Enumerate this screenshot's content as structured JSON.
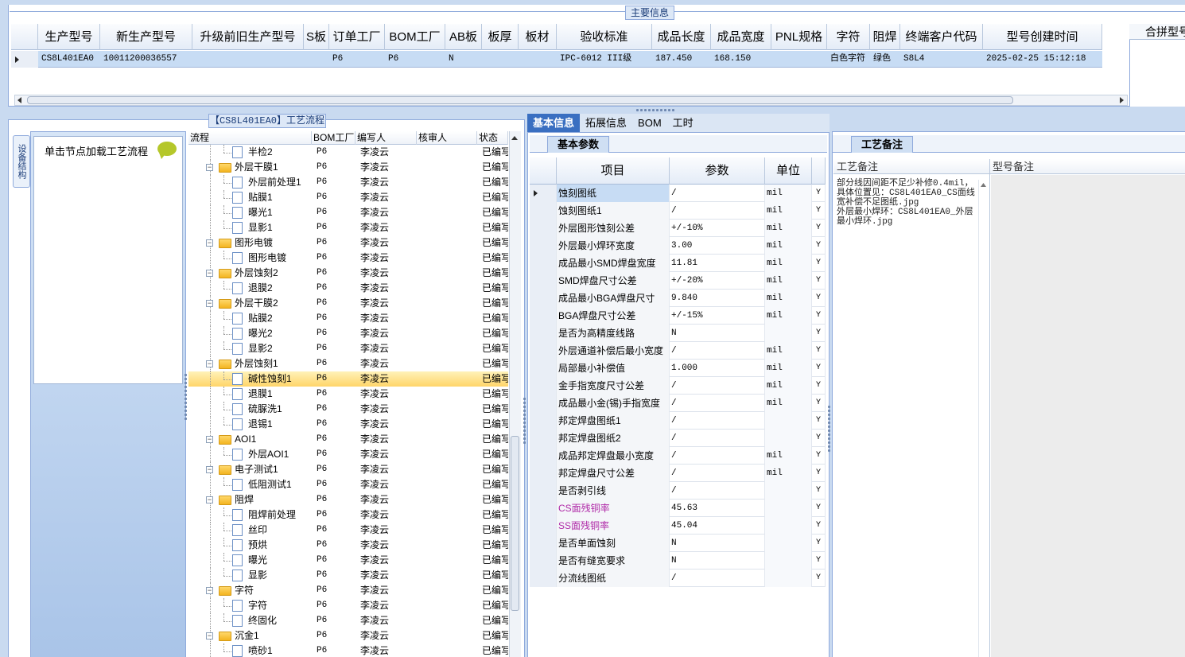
{
  "main_info": {
    "title": "主要信息",
    "columns": [
      "生产型号",
      "新生产型号",
      "升级前旧生产型号",
      "S板",
      "订单工厂",
      "BOM工厂",
      "AB板",
      "板厚",
      "板材",
      "验收标准",
      "成品长度",
      "成品宽度",
      "PNL规格",
      "字符",
      "阻焊",
      "终端客户代码",
      "型号创建时间"
    ],
    "row": [
      "CS8L401EA0",
      "10011200036557",
      "",
      "",
      "P6",
      "P6",
      "N",
      "",
      "",
      "IPC-6012 III级",
      "187.450",
      "168.150",
      "",
      "白色字符",
      "绿色",
      "S8L4",
      "2025-02-25 15:12:18"
    ],
    "right_panel_header": "合拼型号"
  },
  "flow_panel": {
    "title": "【CS8L401EA0】工艺流程",
    "side_tab": "设备结构",
    "hint": "单击节点加载工艺流程",
    "columns": [
      "流程",
      "BOM工厂",
      "编写人",
      "核审人",
      "状态"
    ],
    "nodes": [
      {
        "name": "半检2",
        "type": "doc",
        "level": 2,
        "bom": "P6",
        "writer": "李凌云",
        "reviewer": "",
        "status": "已编写"
      },
      {
        "name": "外层干膜1",
        "type": "folder",
        "level": 1,
        "bom": "P6",
        "writer": "李凌云",
        "reviewer": "",
        "status": "已编写"
      },
      {
        "name": "外层前处理1",
        "type": "doc",
        "level": 2,
        "bom": "P6",
        "writer": "李凌云",
        "reviewer": "",
        "status": "已编写"
      },
      {
        "name": "贴膜1",
        "type": "doc",
        "level": 2,
        "bom": "P6",
        "writer": "李凌云",
        "reviewer": "",
        "status": "已编写"
      },
      {
        "name": "曝光1",
        "type": "doc",
        "level": 2,
        "bom": "P6",
        "writer": "李凌云",
        "reviewer": "",
        "status": "已编写"
      },
      {
        "name": "显影1",
        "type": "doc",
        "level": 2,
        "bom": "P6",
        "writer": "李凌云",
        "reviewer": "",
        "status": "已编写"
      },
      {
        "name": "图形电镀",
        "type": "folder",
        "level": 1,
        "bom": "P6",
        "writer": "李凌云",
        "reviewer": "",
        "status": "已编写"
      },
      {
        "name": "图形电镀",
        "type": "doc",
        "level": 2,
        "bom": "P6",
        "writer": "李凌云",
        "reviewer": "",
        "status": "已编写"
      },
      {
        "name": "外层蚀刻2",
        "type": "folder",
        "level": 1,
        "bom": "P6",
        "writer": "李凌云",
        "reviewer": "",
        "status": "已编写"
      },
      {
        "name": "退膜2",
        "type": "doc",
        "level": 2,
        "bom": "P6",
        "writer": "李凌云",
        "reviewer": "",
        "status": "已编写"
      },
      {
        "name": "外层干膜2",
        "type": "folder",
        "level": 1,
        "bom": "P6",
        "writer": "李凌云",
        "reviewer": "",
        "status": "已编写"
      },
      {
        "name": "贴膜2",
        "type": "doc",
        "level": 2,
        "bom": "P6",
        "writer": "李凌云",
        "reviewer": "",
        "status": "已编写"
      },
      {
        "name": "曝光2",
        "type": "doc",
        "level": 2,
        "bom": "P6",
        "writer": "李凌云",
        "reviewer": "",
        "status": "已编写"
      },
      {
        "name": "显影2",
        "type": "doc",
        "level": 2,
        "bom": "P6",
        "writer": "李凌云",
        "reviewer": "",
        "status": "已编写"
      },
      {
        "name": "外层蚀刻1",
        "type": "folder",
        "level": 1,
        "bom": "P6",
        "writer": "李凌云",
        "reviewer": "",
        "status": "已编写"
      },
      {
        "name": "碱性蚀刻1",
        "type": "doc",
        "level": 2,
        "bom": "P6",
        "writer": "李凌云",
        "reviewer": "",
        "status": "已编写",
        "selected": true
      },
      {
        "name": "退膜1",
        "type": "doc",
        "level": 2,
        "bom": "P6",
        "writer": "李凌云",
        "reviewer": "",
        "status": "已编写"
      },
      {
        "name": "硫脲洗1",
        "type": "doc",
        "level": 2,
        "bom": "P6",
        "writer": "李凌云",
        "reviewer": "",
        "status": "已编写"
      },
      {
        "name": "退锡1",
        "type": "doc",
        "level": 2,
        "bom": "P6",
        "writer": "李凌云",
        "reviewer": "",
        "status": "已编写"
      },
      {
        "name": "AOI1",
        "type": "folder",
        "level": 1,
        "bom": "P6",
        "writer": "李凌云",
        "reviewer": "",
        "status": "已编写"
      },
      {
        "name": "外层AOI1",
        "type": "doc",
        "level": 2,
        "bom": "P6",
        "writer": "李凌云",
        "reviewer": "",
        "status": "已编写"
      },
      {
        "name": "电子测试1",
        "type": "folder",
        "level": 1,
        "bom": "P6",
        "writer": "李凌云",
        "reviewer": "",
        "status": "已编写"
      },
      {
        "name": "低阻测试1",
        "type": "doc",
        "level": 2,
        "bom": "P6",
        "writer": "李凌云",
        "reviewer": "",
        "status": "已编写"
      },
      {
        "name": "阻焊",
        "type": "folder",
        "level": 1,
        "bom": "P6",
        "writer": "李凌云",
        "reviewer": "",
        "status": "已编写"
      },
      {
        "name": "阻焊前处理",
        "type": "doc",
        "level": 2,
        "bom": "P6",
        "writer": "李凌云",
        "reviewer": "",
        "status": "已编写"
      },
      {
        "name": "丝印",
        "type": "doc",
        "level": 2,
        "bom": "P6",
        "writer": "李凌云",
        "reviewer": "",
        "status": "已编写"
      },
      {
        "name": "预烘",
        "type": "doc",
        "level": 2,
        "bom": "P6",
        "writer": "李凌云",
        "reviewer": "",
        "status": "已编写"
      },
      {
        "name": "曝光",
        "type": "doc",
        "level": 2,
        "bom": "P6",
        "writer": "李凌云",
        "reviewer": "",
        "status": "已编写"
      },
      {
        "name": "显影",
        "type": "doc",
        "level": 2,
        "bom": "P6",
        "writer": "李凌云",
        "reviewer": "",
        "status": "已编写"
      },
      {
        "name": "字符",
        "type": "folder",
        "level": 1,
        "bom": "P6",
        "writer": "李凌云",
        "reviewer": "",
        "status": "已编写"
      },
      {
        "name": "字符",
        "type": "doc",
        "level": 2,
        "bom": "P6",
        "writer": "李凌云",
        "reviewer": "",
        "status": "已编写"
      },
      {
        "name": "终固化",
        "type": "doc",
        "level": 2,
        "bom": "P6",
        "writer": "李凌云",
        "reviewer": "",
        "status": "已编写"
      },
      {
        "name": "沉金1",
        "type": "folder",
        "level": 1,
        "bom": "P6",
        "writer": "李凌云",
        "reviewer": "",
        "status": "已编写"
      },
      {
        "name": "喷砂1",
        "type": "doc",
        "level": 2,
        "bom": "P6",
        "writer": "李凌云",
        "reviewer": "",
        "status": "已编写"
      }
    ]
  },
  "detail_panel": {
    "tabs": [
      "基本信息",
      "拓展信息",
      "BOM",
      "工时"
    ],
    "active_tab": 0,
    "subtab": "基本参数",
    "columns": [
      "项目",
      "参数",
      "单位"
    ],
    "params": [
      {
        "item": "蚀刻图纸",
        "value": "/",
        "unit": "mil",
        "flag": "Y",
        "current": true
      },
      {
        "item": "蚀刻图纸1",
        "value": "/",
        "unit": "mil",
        "flag": "Y"
      },
      {
        "item": "外层图形蚀刻公差",
        "value": "+/-10%",
        "unit": "mil",
        "flag": "Y"
      },
      {
        "item": "外层最小焊环宽度",
        "value": "3.00",
        "unit": "mil",
        "flag": "Y"
      },
      {
        "item": "成品最小SMD焊盘宽度",
        "value": "11.81",
        "unit": "mil",
        "flag": "Y"
      },
      {
        "item": "SMD焊盘尺寸公差",
        "value": "+/-20%",
        "unit": "mil",
        "flag": "Y"
      },
      {
        "item": "成品最小BGA焊盘尺寸",
        "value": "9.840",
        "unit": "mil",
        "flag": "Y"
      },
      {
        "item": "BGA焊盘尺寸公差",
        "value": "+/-15%",
        "unit": "mil",
        "flag": "Y"
      },
      {
        "item": "是否为高精度线路",
        "value": "N",
        "unit": "",
        "flag": "Y"
      },
      {
        "item": "外层通道补偿后最小宽度",
        "value": "/",
        "unit": "mil",
        "flag": "Y"
      },
      {
        "item": "局部最小补偿值",
        "value": "1.000",
        "unit": "mil",
        "flag": "Y"
      },
      {
        "item": "金手指宽度尺寸公差",
        "value": "/",
        "unit": "mil",
        "flag": "Y"
      },
      {
        "item": "成品最小金(锡)手指宽度",
        "value": "/",
        "unit": "mil",
        "flag": "Y"
      },
      {
        "item": "邦定焊盘图纸1",
        "value": "/",
        "unit": "",
        "flag": "Y"
      },
      {
        "item": "邦定焊盘图纸2",
        "value": "/",
        "unit": "",
        "flag": "Y"
      },
      {
        "item": "成品邦定焊盘最小宽度",
        "value": "/",
        "unit": "mil",
        "flag": "Y"
      },
      {
        "item": "邦定焊盘尺寸公差",
        "value": "/",
        "unit": "mil",
        "flag": "Y"
      },
      {
        "item": "是否剥引线",
        "value": "/",
        "unit": "",
        "flag": "Y"
      },
      {
        "item": "CS面残铜率",
        "value": "45.63",
        "unit": "",
        "flag": "Y",
        "pink": true
      },
      {
        "item": "SS面残铜率",
        "value": "45.04",
        "unit": "",
        "flag": "Y",
        "pink": true
      },
      {
        "item": "是否单面蚀刻",
        "value": "N",
        "unit": "",
        "flag": "Y"
      },
      {
        "item": "是否有缝宽要求",
        "value": "N",
        "unit": "",
        "flag": "Y"
      },
      {
        "item": "分流线图纸",
        "value": "/",
        "unit": "",
        "flag": "Y"
      }
    ]
  },
  "notes_panel": {
    "tab": "工艺备注",
    "process_note_label": "工艺备注",
    "model_note_label": "型号备注",
    "process_note_text": "部分线因间距不足少补修0.4mil，具体位置见：CS8L401EA0_CS面线宽补偿不足图纸.jpg\n外层最小焊环：CS8L401EA0_外层最小焊环.jpg"
  },
  "colors": {
    "selection": "#c7dcf4",
    "accent_tab": "#3a6fc1",
    "tree_selection": "#ffd56a",
    "pink_text": "#b02aa8"
  }
}
